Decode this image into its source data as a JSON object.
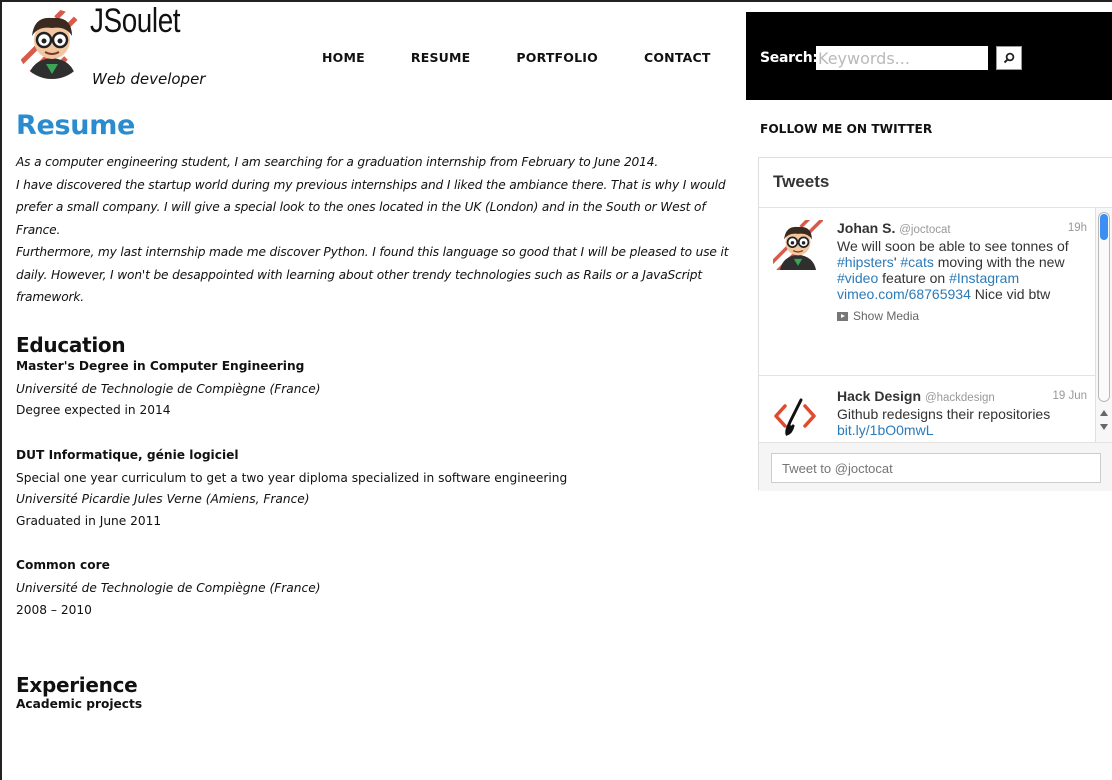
{
  "header": {
    "logo_name": "JSoulet",
    "logo_subtitle": "Web developer",
    "nav": [
      "HOME",
      "RESUME",
      "PORTFOLIO",
      "CONTACT"
    ],
    "search_label": "Search:",
    "search_placeholder": "Keywords...",
    "search_icon": "search-icon"
  },
  "main": {
    "title": "Resume",
    "intro": [
      "As a computer engineering student, I am searching for a graduation internship from February to June 2014.",
      "I have discovered the startup world during my previous internships and I liked the ambiance there. That is why I would prefer a small company. I will give a special look to the ones located in the UK (London) and in the South or West of France.",
      "Furthermore, my last internship made me discover Python. I found this language so good that I will be pleased to use it daily. However, I won't be desappointed with learning about other trendy technologies such as Rails or a JavaScript framework."
    ],
    "education_title": "Education",
    "education": [
      {
        "title": "Master's Degree in Computer Engineering",
        "desc": "",
        "school": "Université de Technologie de Compiègne (France)",
        "date": "Degree expected in 2014"
      },
      {
        "title": "DUT Informatique, génie logiciel",
        "desc": "Special one year curriculum to get a two year diploma specialized in software engineering",
        "school": "Université Picardie Jules Verne (Amiens, France)",
        "date": "Graduated in June 2011"
      },
      {
        "title": "Common core",
        "desc": "",
        "school": "Université de Technologie de Compiègne (France)",
        "date": "2008 – 2010"
      }
    ],
    "experience_title": "Experience",
    "experience_first": "Academic projects"
  },
  "sidebar": {
    "follow_label": "FOLLOW ME ON TWITTER",
    "widget_title": "Tweets",
    "tweets": [
      {
        "name": "Johan S.",
        "handle": "@joctocat",
        "time": "19h",
        "text_parts": [
          "We will soon be able to see tonnes of ",
          "#hipsters",
          "' ",
          "#cats",
          " moving with the new ",
          "#video",
          " feature on ",
          "#Instagram",
          " ",
          "vimeo.com/68765934",
          " Nice vid btw"
        ],
        "media_label": "Show Media"
      },
      {
        "name": "Hack Design",
        "handle": "@hackdesign",
        "time": "19 Jun",
        "text_parts": [
          "Github redesigns their repositories ",
          "bit.ly/1bO0mwL"
        ]
      }
    ],
    "tweet_placeholder": "Tweet to @joctocat"
  }
}
